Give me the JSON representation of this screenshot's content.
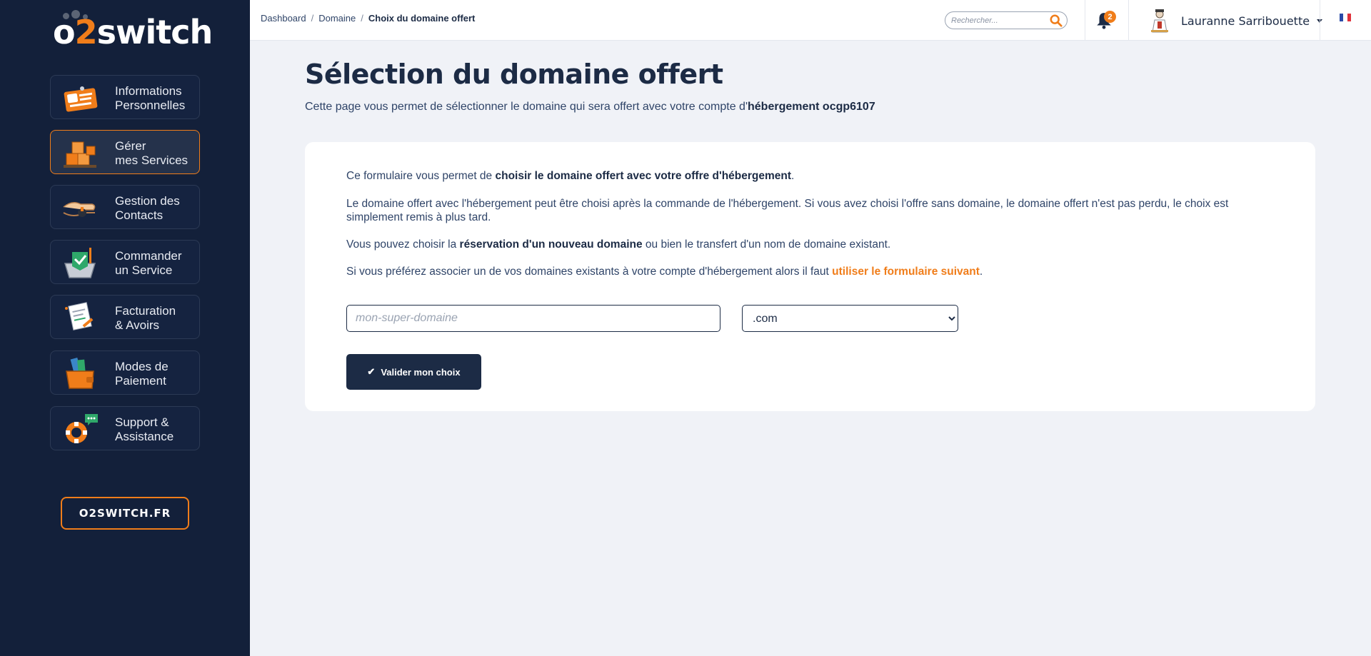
{
  "brand": {
    "logo_prefix": "o",
    "logo_two": "2",
    "logo_suffix": "switch",
    "site_button": "O2SWITCH.FR",
    "colors": {
      "sidebar": "#13203a",
      "accent": "#f07d1a",
      "text_dark": "#1c2b45",
      "page_bg": "#f0f2f7"
    }
  },
  "sidebar": {
    "items": [
      {
        "label": "Informations\nPersonnelles",
        "icon": "id-card-icon",
        "active": false
      },
      {
        "label": "Gérer\nmes Services",
        "icon": "boxes-icon",
        "active": true
      },
      {
        "label": "Gestion des\nContacts",
        "icon": "handshake-icon",
        "active": false
      },
      {
        "label": "Commander\nun Service",
        "icon": "shopping-basket-icon",
        "active": false
      },
      {
        "label": "Facturation\n& Avoirs",
        "icon": "invoice-icon",
        "active": false
      },
      {
        "label": "Modes de\nPaiement",
        "icon": "wallet-icon",
        "active": false
      },
      {
        "label": "Support &\nAssistance",
        "icon": "lifebuoy-icon",
        "active": false
      }
    ]
  },
  "topbar": {
    "breadcrumb": {
      "items": [
        "Dashboard",
        "Domaine"
      ],
      "current": "Choix du domaine offert"
    },
    "search": {
      "placeholder": "Rechercher..."
    },
    "notifications": {
      "count": "2"
    },
    "user": {
      "name": "Lauranne Sarribouette"
    },
    "language": "fr"
  },
  "main": {
    "title": "Sélection du domaine offert",
    "subtitle_text": "Cette page vous permet de sélectionner le domaine qui sera offert avec votre compte d'",
    "subtitle_bold": "hébergement ocgp6107",
    "card": {
      "p1_text": "Ce formulaire vous permet de ",
      "p1_bold": "choisir le domaine offert avec votre offre d'hébergement",
      "p1_end": ".",
      "p2": "Le domaine offert avec l'hébergement peut être choisi après la commande de l'hébergement. Si vous avez choisi l'offre sans domaine, le domaine offert n'est pas perdu, le choix est simplement remis à plus tard.",
      "p3_text": "Vous pouvez choisir la ",
      "p3_bold": "réservation d'un nouveau domaine",
      "p3_end": " ou bien le transfert d'un nom de domaine existant.",
      "p4_text": "Si vous préférez associer un de vos domaines existants à votre compte d'hébergement alors il faut ",
      "p4_link": "utiliser le formulaire suivant",
      "p4_end": ".",
      "domain_placeholder": "mon-super-domaine",
      "domain_value": "",
      "tld_selected": ".com",
      "submit_label": "Valider mon choix"
    }
  }
}
